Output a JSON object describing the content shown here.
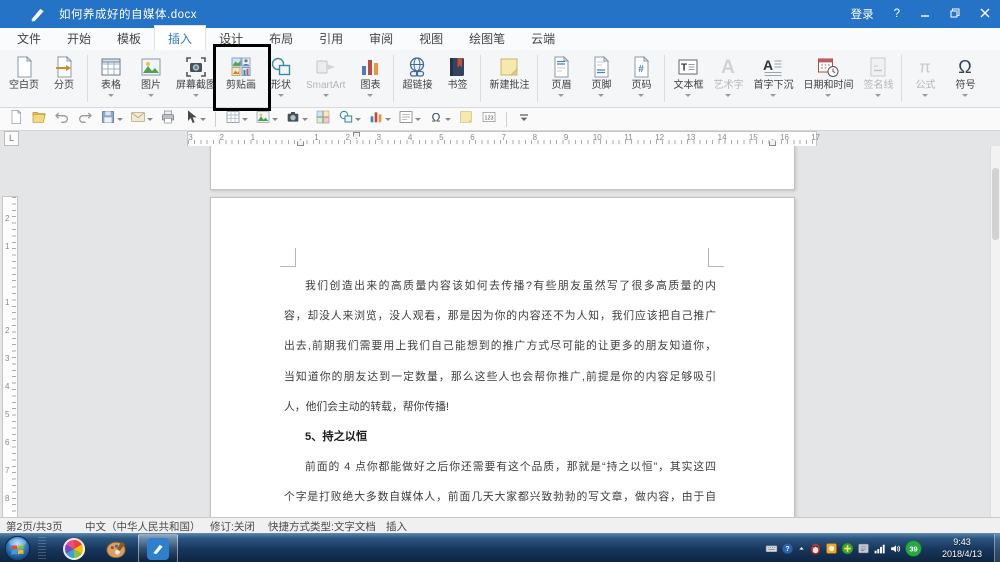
{
  "app": {
    "title": "如何养成好的自媒体.docx",
    "login_label": "登录",
    "help_label": "?"
  },
  "tabs": [
    {
      "name": "tab-file",
      "label": "文件"
    },
    {
      "name": "tab-home",
      "label": "开始"
    },
    {
      "name": "tab-template",
      "label": "模板"
    },
    {
      "name": "tab-insert",
      "label": "插入",
      "active": true
    },
    {
      "name": "tab-design",
      "label": "设计"
    },
    {
      "name": "tab-layout",
      "label": "布局"
    },
    {
      "name": "tab-references",
      "label": "引用"
    },
    {
      "name": "tab-review",
      "label": "审阅"
    },
    {
      "name": "tab-view",
      "label": "视图"
    },
    {
      "name": "tab-drawing-pen",
      "label": "绘图笔"
    },
    {
      "name": "tab-cloud",
      "label": "云端"
    }
  ],
  "ribbon": {
    "groups": [
      {
        "buttons": [
          {
            "name": "blank-page",
            "label": "空白页",
            "icon": "blank-page-icon"
          },
          {
            "name": "page-break",
            "label": "分页",
            "icon": "page-break-icon"
          }
        ]
      },
      {
        "buttons": [
          {
            "name": "table",
            "label": "表格",
            "icon": "table-icon",
            "caret": true
          },
          {
            "name": "picture",
            "label": "图片",
            "icon": "picture-icon",
            "caret": true
          },
          {
            "name": "screenshot",
            "label": "屏幕截图",
            "icon": "screenshot-icon",
            "caret": true
          },
          {
            "name": "clipart",
            "label": "剪贴画",
            "icon": "clipart-icon",
            "annotated": true
          },
          {
            "name": "shapes",
            "label": "形状",
            "icon": "shapes-icon",
            "caret": true
          },
          {
            "name": "smartart",
            "label": "SmartArt",
            "icon": "smartart-icon",
            "caret": true,
            "disabled": true
          },
          {
            "name": "chart",
            "label": "图表",
            "icon": "chart-icon",
            "caret": true
          }
        ]
      },
      {
        "buttons": [
          {
            "name": "hyperlink",
            "label": "超链接",
            "icon": "hyperlink-icon"
          },
          {
            "name": "bookmark",
            "label": "书签",
            "icon": "bookmark-icon"
          }
        ]
      },
      {
        "buttons": [
          {
            "name": "new-comment",
            "label": "新建批注",
            "icon": "comment-icon"
          }
        ]
      },
      {
        "buttons": [
          {
            "name": "page-header",
            "label": "页眉",
            "icon": "header-icon",
            "caret": true
          },
          {
            "name": "page-footer",
            "label": "页脚",
            "icon": "footer-icon",
            "caret": true
          },
          {
            "name": "page-number",
            "label": "页码",
            "icon": "page-number-icon",
            "caret": true
          }
        ]
      },
      {
        "buttons": [
          {
            "name": "text-box",
            "label": "文本框",
            "icon": "textbox-icon",
            "caret": true
          },
          {
            "name": "word-art",
            "label": "艺术字",
            "icon": "wordart-icon",
            "caret": true,
            "disabled": true
          },
          {
            "name": "drop-cap",
            "label": "首字下沉",
            "icon": "dropcap-icon",
            "caret": true
          },
          {
            "name": "date-time",
            "label": "日期和时间",
            "icon": "datetime-icon",
            "caret": true
          },
          {
            "name": "signature-line",
            "label": "签名线",
            "icon": "signature-icon",
            "caret": true,
            "disabled": true
          }
        ]
      },
      {
        "buttons": [
          {
            "name": "formula",
            "label": "公式",
            "icon": "formula-icon",
            "caret": true,
            "disabled": true
          },
          {
            "name": "symbol",
            "label": "符号",
            "icon": "symbol-icon",
            "caret": true
          }
        ]
      }
    ]
  },
  "toolbar": {
    "items": [
      {
        "name": "new-doc",
        "icon": "mini-new"
      },
      {
        "name": "open-file",
        "icon": "mini-open"
      },
      {
        "name": "undo",
        "icon": "mini-undo"
      },
      {
        "name": "redo",
        "icon": "mini-redo"
      },
      {
        "name": "save",
        "icon": "mini-save",
        "caret": true
      },
      {
        "name": "send-email",
        "icon": "mini-mail",
        "caret": true
      },
      {
        "name": "print",
        "icon": "mini-print"
      },
      {
        "name": "select-tool",
        "icon": "mini-select",
        "caret": true
      },
      {
        "sep": true
      },
      {
        "name": "insert-table",
        "icon": "mini-table",
        "caret": true
      },
      {
        "name": "insert-picture",
        "icon": "mini-picture",
        "caret": true
      },
      {
        "name": "insert-screenshot",
        "icon": "mini-camera",
        "caret": true
      },
      {
        "name": "insert-clipart",
        "icon": "mini-clipart"
      },
      {
        "name": "insert-shapes",
        "icon": "mini-shapes",
        "caret": true
      },
      {
        "name": "insert-chart",
        "icon": "mini-chart",
        "caret": true
      },
      {
        "name": "insert-frame",
        "icon": "mini-frame",
        "caret": true
      },
      {
        "name": "insert-symbol",
        "icon": "mini-omega",
        "caret": true
      },
      {
        "name": "sticky-note",
        "icon": "mini-note"
      },
      {
        "name": "word-count",
        "icon": "mini-abc"
      },
      {
        "sep": true
      },
      {
        "name": "toolbar-more",
        "icon": "mini-more"
      }
    ]
  },
  "ruler": {
    "tab_selector": "L",
    "left_numbers": [
      "3",
      "2",
      "1"
    ],
    "numbers": [
      "1",
      "2",
      "3",
      "4",
      "5",
      "6",
      "7",
      "8",
      "9",
      "10",
      "11",
      "12",
      "13",
      "14",
      "15",
      "16",
      "17"
    ]
  },
  "vruler": {
    "numbers": [
      "2",
      "1",
      "1",
      "2",
      "3",
      "4",
      "5",
      "6",
      "7",
      "8"
    ]
  },
  "document": {
    "lines": [
      {
        "text": "我们创造出来的高质量内容该如何去传播?有些朋友虽然写了很多高质量的内",
        "indent": true,
        "full": true
      },
      {
        "text": "容，却没人来浏览，没人观看，那是因为你的内容还不为人知，我们应该把自己推广",
        "full": true
      },
      {
        "text": "出去,前期我们需要用上我们自己能想到的推广方式尽可能的让更多的朋友知道你，",
        "full": true
      },
      {
        "text": "当知道你的朋友达到一定数量，那么这些人也会帮你推广,前提是你的内容足够吸引",
        "full": true
      },
      {
        "text": "人，他们会主动的转载，帮你传播!"
      },
      {
        "text": "5、持之以恒",
        "indent": true,
        "bold": true
      },
      {
        "text": "前面的 4 点你都能做好之后你还需要有这个品质，那就是“持之以恒”，其实这四",
        "indent": true,
        "full": true
      },
      {
        "text": "个字是打败绝大多数自媒体人，前面几天大家都兴致勃勃的写文章，做内容，由于自",
        "full": true
      }
    ]
  },
  "status": {
    "items": [
      {
        "name": "status-page-indicator",
        "text": "第2页/共3页"
      },
      {
        "name": "status-language",
        "text": "中文（中华人民共和国）"
      },
      {
        "name": "status-track-changes",
        "text": "修订:关闭"
      },
      {
        "name": "status-doc-type",
        "text": "快捷方式类型:文字文档"
      },
      {
        "name": "status-insert-mode",
        "text": "插入"
      }
    ]
  },
  "taskbar": {
    "apps": [
      {
        "name": "pinwheel-app-icon"
      },
      {
        "name": "paint-app-icon"
      },
      {
        "name": "wps-app-icon",
        "active": true
      }
    ],
    "tray": [
      {
        "name": "keyboard-icon"
      },
      {
        "name": "help-tray-icon"
      },
      {
        "name": "show-hidden-icons"
      },
      {
        "name": "qq-icon"
      },
      {
        "name": "orange-app-icon"
      },
      {
        "name": "shield-icon"
      },
      {
        "name": "gray-app-icon"
      },
      {
        "name": "network-icon"
      },
      {
        "name": "volume-icon"
      },
      {
        "name": "optimizer-badge",
        "text": "39"
      }
    ],
    "clock": {
      "time": "9:43",
      "date": "2018/4/13"
    }
  }
}
